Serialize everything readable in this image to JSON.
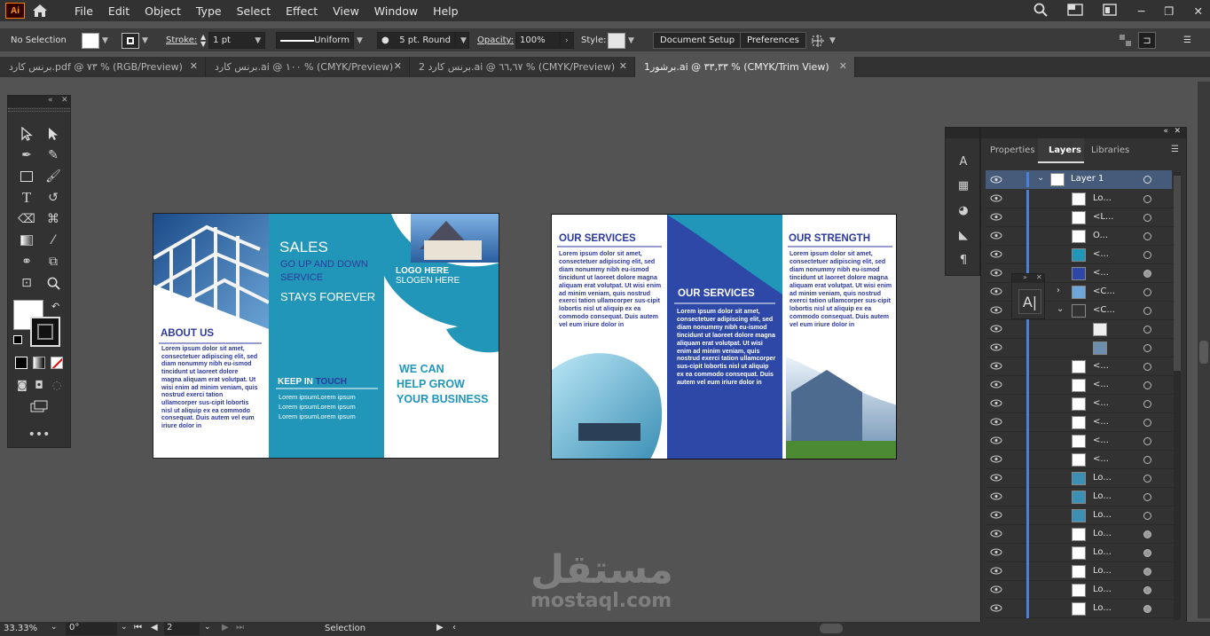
{
  "app": {
    "logo": "Ai"
  },
  "menu": [
    "File",
    "Edit",
    "Object",
    "Type",
    "Select",
    "Effect",
    "View",
    "Window",
    "Help"
  ],
  "control": {
    "selection": "No Selection",
    "stroke_label": "Stroke:",
    "stroke_value": "1 pt",
    "profile": "Uniform",
    "brush": "5 pt. Round",
    "opacity_label": "Opacity:",
    "opacity_value": "100%",
    "style_label": "Style:",
    "doc_setup": "Document Setup",
    "preferences": "Preferences"
  },
  "tabs": [
    {
      "label": "برنس كارد.pdf @ ٧٣ % (RGB/Preview)"
    },
    {
      "label": "برنس كارد.ai @ ١٠٠ % (CMYK/Preview)"
    },
    {
      "label": "برنس كارد 2.ai @ ٦٦,٦٧ % (CMYK/Preview)"
    },
    {
      "label": "برشور1.ai @ ٣٣,٣٣ % (CMYK/Trim View)"
    }
  ],
  "brochure1": {
    "sales": "SALES",
    "go_up": "GO UP AND DOWN",
    "service": "SERVICE",
    "stays": "STAYS FOREVER",
    "logo_here": "LOGO HERE",
    "slogen": "SLOGEN HERE",
    "about": "ABOUT US",
    "lorem": "Lorem ipsum dolor sit amet, consectetuer adipiscing elit, sed diam nonummy nibh eu-ismod tincidunt ut laoreet dolore magna aliquam erat volutpat. Ut wisi enim ad minim veniam, quis nostrud exerci tation ullamcorper sus-cipit lobortis nisl ut aliquip ex ea commodo consequat. Duis autem vel eum iriure dolor in",
    "keep_in": "KEEP IN",
    "touch": "TOUCH",
    "contact1": "Lorem ipsumLorem ipsum",
    "contact2": "Lorem ipsumLorem ipsum",
    "contact3": "Lorem ipsumLorem ipsum",
    "we_can": "WE CAN",
    "help_grow": "HELP GROW",
    "your_business": "YOUR BUSINESS"
  },
  "brochure2": {
    "our_services": "OUR SERVICES",
    "our_services2": "OUR SERVICES",
    "our_strength": "OUR STRENGTH",
    "lorem1": "Lorem ipsum dolor sit amet, consectetuer adipiscing elit, sed diam nonummy nibh eu-ismod tincidunt ut laoreet dolore magna aliquam erat volutpat. Ut wisi enim ad minim veniam, quis nostrud exerci tation ullamcorper sus-cipit lobortis nisl ut aliquip ex ea commodo consequat. Duis autem vel eum iriure dolor in",
    "lorem2": "Lorem ipsum dolor sit amet, consectetuer adipiscing elit, sed diam nonummy nibh eu-ismod tincidunt ut laoreet dolore magna aliquam erat volutpat. Ut wisi enim ad minim veniam, quis nostrud exerci tation ullamcorper sus-cipit lobortis nisl ut aliquip ex ea commodo consequat. Duis autem vel eum iriure dolor in",
    "lorem3": "Lorem ipsum dolor sit amet, consectetuer adipiscing elit, sed diam nonummy nibh eu-ismod tincidunt ut laoreet dolore magna aliquam erat volutpat. Ut wisi enim ad minim veniam, quis nostrud exerci tation ullamcorper sus-cipit lobortis nisl ut aliquip ex ea commodo consequat. Duis autem vel eum iriure dolor in"
  },
  "panel": {
    "tabs": [
      "Properties",
      "Layers",
      "Libraries"
    ],
    "layer_name": "Layer 1",
    "rows": [
      "Lo...",
      "<L...",
      "O...",
      "<...",
      "<...",
      "<C...",
      "<C...",
      "",
      "",
      "<...",
      "<...",
      "<...",
      "<...",
      "<...",
      "<...",
      "Lo...",
      "Lo...",
      "Lo...",
      "Lo...",
      "Lo...",
      "Lo...",
      "Lo...",
      "Lo..."
    ]
  },
  "status": {
    "zoom": "33.33%",
    "rotate": "0°",
    "artboard": "2",
    "tool": "Selection"
  },
  "watermark": {
    "arabic": "مستقل",
    "latin": "mostaql.com"
  }
}
